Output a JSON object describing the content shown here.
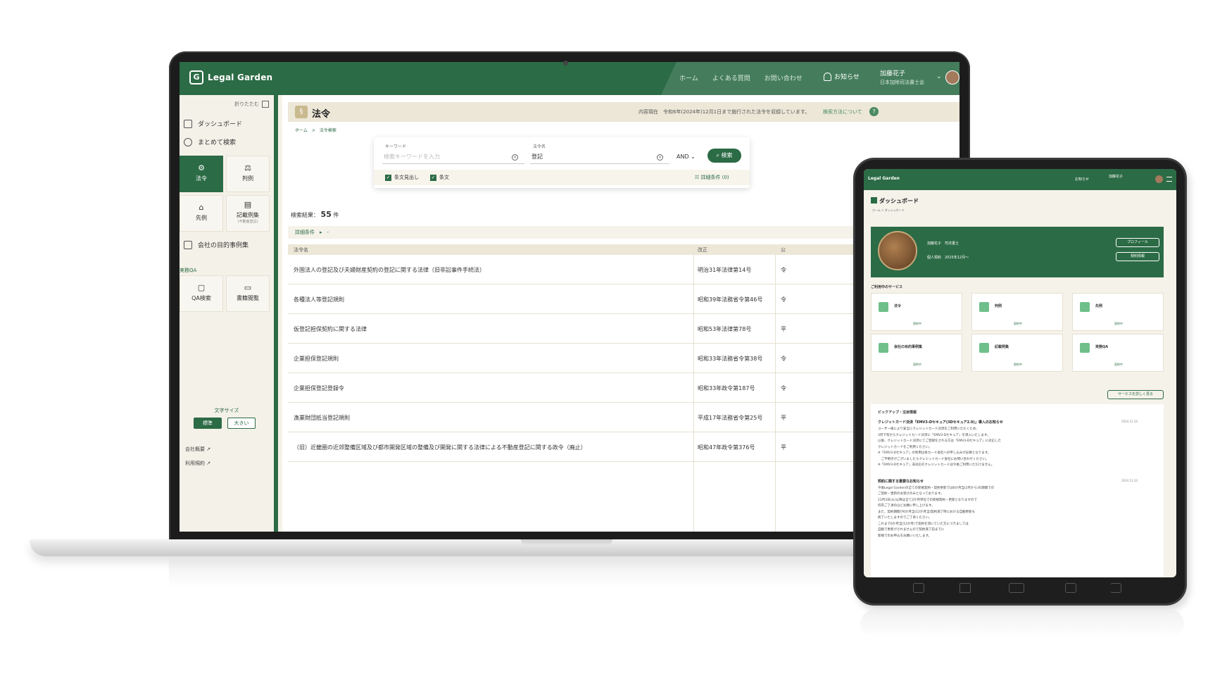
{
  "laptop": {
    "app": {
      "logo_mark": "G",
      "logo_text": "Legal Garden",
      "nav": [
        "ホーム",
        "よくある質問",
        "お問い合わせ"
      ],
      "notice_label": "お知らせ",
      "user_name": "加藤花子",
      "user_org": "日本加除司法書士会",
      "caret": "⌄"
    },
    "sidebar": {
      "collapse_label": "折りたたむ",
      "dashboard": "ダッシュボード",
      "search_all": "まとめて検索",
      "tiles": {
        "laws": "法令",
        "cases": "判例",
        "precedents": "先例",
        "examples": "記載例集",
        "examples_sub": "(不動産登記)",
        "qa_search": "QA検索",
        "books": "書籍閲覧"
      },
      "company_purpose": "会社の目的事例集",
      "qa_label": "実務QA",
      "font_size_label": "文字サイズ",
      "font_standard": "標準",
      "font_large": "大きい",
      "footer_links": [
        "会社概要 ↗",
        "利用規約 ↗"
      ]
    },
    "main": {
      "page_title": "法令",
      "page_title_icon": "§",
      "notice": "内容現在　令和6年(2024年)12月1日まで施行された法令を収録しています。",
      "help_link": "検索方法について",
      "help_icon": "?",
      "breadcrumb": "ホーム　>　法令検索",
      "search": {
        "keyword_label": "キーワード",
        "keyword_placeholder": "検索キーワードを入力",
        "law_label": "法令名",
        "law_value": "登記",
        "clear_icon": "×",
        "operator": "AND ⌄",
        "search_button": "⌕ 検索",
        "check_headings": "条文見出し",
        "check_articles": "条文",
        "check_mark": "✓",
        "detail_link": "☷ 詳細条件 (0)"
      },
      "result_prefix": "検索結果：",
      "result_count": "55",
      "result_suffix": "件",
      "detail_bar": "詳細条件　▸　-",
      "table": {
        "headers": [
          "法令名",
          "改正",
          "公"
        ],
        "rows": [
          {
            "name": "外国法人の登記及び夫婦財産契約の登記に関する法律（旧非訟事件手続法）",
            "rev": "明治31年法律第14号",
            "pub": "令"
          },
          {
            "name": "各種法人等登記規則",
            "rev": "昭和39年法務省令第46号",
            "pub": "令"
          },
          {
            "name": "仮登記担保契約に関する法律",
            "rev": "昭和53年法律第78号",
            "pub": "平"
          },
          {
            "name": "企業担保登記規則",
            "rev": "昭和33年法務省令第38号",
            "pub": "令"
          },
          {
            "name": "企業担保登記登録令",
            "rev": "昭和33年政令第187号",
            "pub": "令"
          },
          {
            "name": "漁業財団抵当登記規則",
            "rev": "平成17年法務省令第25号",
            "pub": "平"
          },
          {
            "name": "（旧）近畿圏の近郊整備区域及び都市開発区域の整備及び開発に関する法律による不動産登記に関する政令（廃止）",
            "rev": "昭和47年政令第376号",
            "pub": "平"
          }
        ]
      }
    }
  },
  "tablet": {
    "logo": "Legal Garden",
    "notice": "お知らせ",
    "user": "加藤花子",
    "page_title": "ダッシュボード",
    "breadcrumb": "ホーム > ダッシュボード",
    "banner": {
      "name": "加藤花子　司法書士",
      "contract": "個人契約　2025年12月〜",
      "profile_button": "プロフィール",
      "contract_button": "契約情報"
    },
    "services_label": "ご利用中のサービス",
    "services": [
      {
        "name": "法令",
        "status": "契約中"
      },
      {
        "name": "判例",
        "status": "契約中"
      },
      {
        "name": "先例",
        "status": "契約中"
      },
      {
        "name": "会社の目的事例集",
        "status": "契約中"
      },
      {
        "name": "記載例集",
        "status": "契約中"
      },
      {
        "name": "実務QA",
        "status": "契約中"
      }
    ],
    "more_button": "サービスを詳しく見る",
    "news_label": "ピックアップ・注目情報",
    "news": [
      {
        "title": "クレジットカード決済「EMV3-Dセキュア(3Dセキュア2.0)」導入のお知らせ",
        "date": "2024.12.24",
        "lines": [
          "ユーザー様により安全にクレジットカード決済をご利用いただくため、",
          "3月下旬からクレジットカード決済に「EMV3-Dセキュア」を導入いたします。",
          "以後、クレジットカード決済にてご登録をされる方は「EMV3-Dセキュア」に対応した",
          "クレジットカードをご利用ください。",
          "※「EMV3-Dセキュア」の利用は各カード会社への申し込みが必要となります。",
          "　ご不明点がございましたらクレジットカード会社にお問い合わせください。",
          "※「EMV3-Dセキュア」非対応のクレジットカードは今後ご利用いただけません。"
        ]
      },
      {
        "title": "契約に関する重要なお知らせ",
        "date": "2024.12.24",
        "lines": [
          "今後Legal Gardenの全ての新規契約・契約更新では6か月当(2月から)の期間での",
          "ご契約・更新のお受けのみとなっております。",
          "12月3日(火)以降は全て2か月単位での新規契約・更新となりますので",
          "何卒ご了承のほどお願い申し上げます。",
          "また、契約期間が6か月当(12か月当)契約満了時における自動更新も",
          "終了いたしますのでご了承ください。",
          "これまで6か月当(12か月)で契約を頂いていた方につきましては",
          "自動で更新がされませんので契約満了前までに",
          "新規でのお申込をお願いいたします。"
        ]
      }
    ]
  },
  "colors": {
    "brand_green": "#2b6b45",
    "cream": "#f5f2ea",
    "tan_header": "#ece7d7",
    "service_icon": "#6fbf8a"
  },
  "icons": [
    "bell-icon",
    "dashboard-icon",
    "search-icon",
    "law-icon",
    "gavel-icon",
    "building-icon",
    "document-icon",
    "book-icon",
    "external-link-icon",
    "question-icon",
    "clear-icon",
    "checkbox-icon",
    "menu-icon"
  ]
}
